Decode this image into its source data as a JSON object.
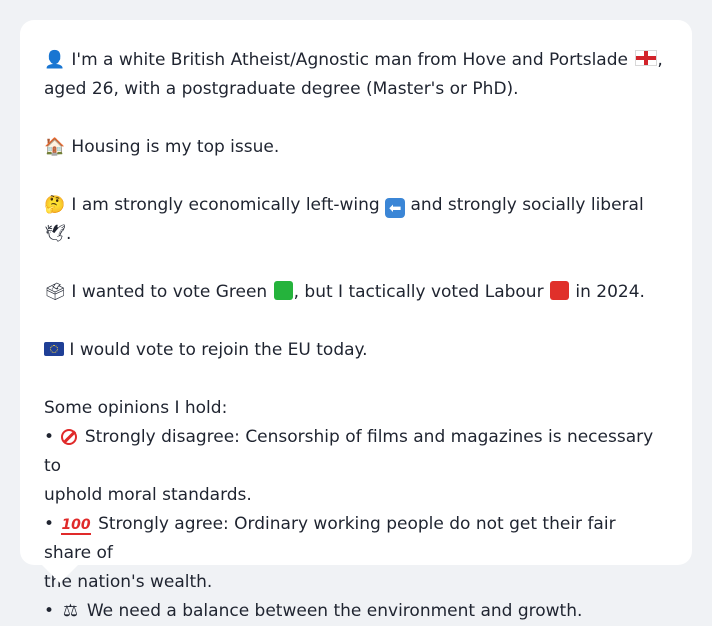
{
  "message": {
    "intro_line1_text": "I'm a white British Atheist/Agnostic man from Hove and Portslade",
    "intro_line1_tail": ",",
    "intro_line2": "aged 26, with a postgraduate degree (Master's or PhD).",
    "housing": "Housing is my top issue.",
    "economic_a": "I am strongly economically left-wing",
    "economic_b": "and strongly socially liberal",
    "economic_c": ".",
    "vote_a": "I wanted to vote Green",
    "vote_b": ", but I tactically voted Labour",
    "vote_c": "in 2024.",
    "eu": "I would vote to rejoin the EU today.",
    "opinions_heading": "Some opinions I hold:",
    "opinion1_line1": "Strongly disagree: Censorship of films and magazines is necessary to",
    "opinion1_line2": "uphold moral standards.",
    "opinion2_line1": "Strongly agree: Ordinary working people do not get their fair share of",
    "opinion2_line2": "the nation's wealth.",
    "opinion3": "We need a balance between the environment and growth.",
    "bullet": "•"
  },
  "icons": {
    "person": "👤",
    "england_flag": "england-flag-icon",
    "house": "🏠",
    "thinking": "🤔",
    "left_arrow": "⬅",
    "dove": "🕊",
    "ballot_box": "🗳",
    "green_square": "#25b33c",
    "red_square": "#e0302a",
    "eu_flag": "eu-flag-icon",
    "prohibited": "prohibited-icon",
    "hundred": "100",
    "scales": "⚖"
  }
}
